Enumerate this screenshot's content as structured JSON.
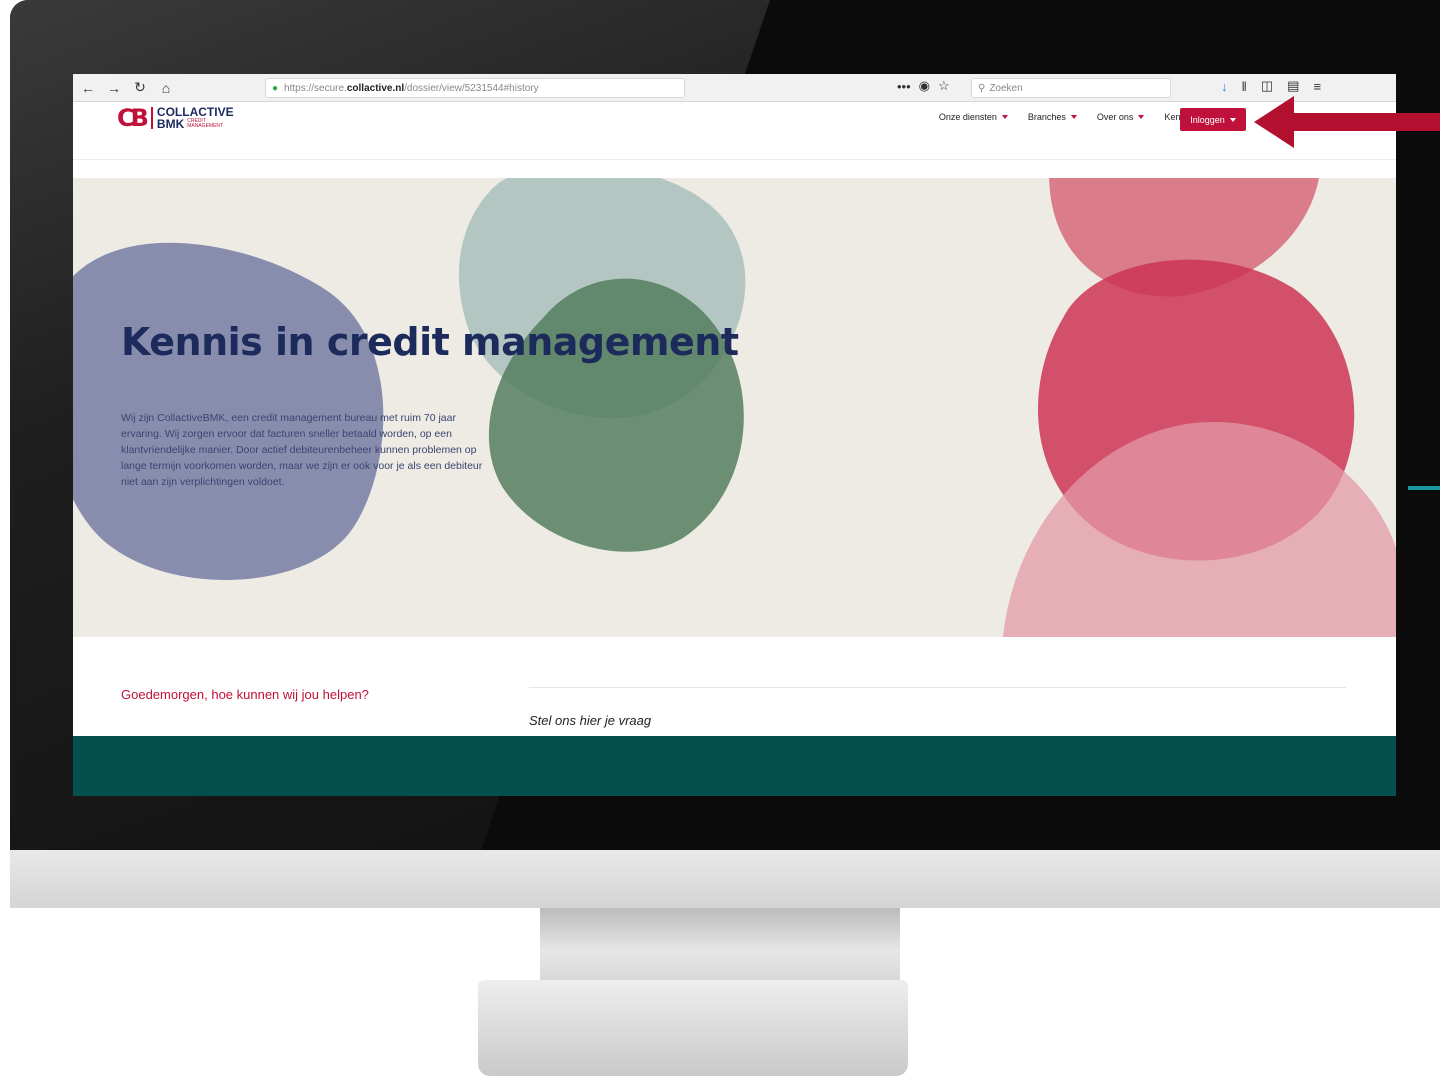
{
  "browser": {
    "back_icon": "back-arrow-icon",
    "forward_icon": "forward-arrow-icon",
    "reload_icon": "reload-icon",
    "home_icon": "home-icon",
    "url_prefix": "https://secure.",
    "url_domain": "collactive.nl",
    "url_path": "/dossier/view/5231544#history",
    "search_placeholder": "Zoeken",
    "page_actions": "•••",
    "accent": "#2aa84a"
  },
  "header": {
    "logo_mark": "CB",
    "logo_line1": "COLLACTIVE",
    "logo_line2": "BMK",
    "logo_sub1": "CREDIT",
    "logo_sub2": "MANAGEMENT",
    "nav": [
      {
        "label": "Onze diensten"
      },
      {
        "label": "Branches"
      },
      {
        "label": "Over ons"
      },
      {
        "label": "Kennisbibliotheek"
      }
    ],
    "login_label": "Inloggen",
    "brand_color": "#c0113a",
    "navy": "#1d2b5c"
  },
  "hero": {
    "title": "Kennis in credit management",
    "text": "Wij zijn CollactiveBMK, een credit management bureau met ruim 70 jaar ervaring. Wij zorgen ervoor dat facturen sneller betaald worden, op een klantvriendelijke manier. Door actief debiteurenbeheer kunnen problemen op lange termijn voorkomen worden, maar we zijn er ook voor je als een debiteur niet aan zijn verplichtingen voldoet.",
    "background": "#eeebe4"
  },
  "help": {
    "greeting": "Goedemorgen, hoe kunnen wij jou helpen?",
    "question": "Stel ons hier je vraag"
  },
  "footer": {
    "color": "#04504f"
  },
  "annotation": {
    "arrow_color": "#b3102f"
  }
}
